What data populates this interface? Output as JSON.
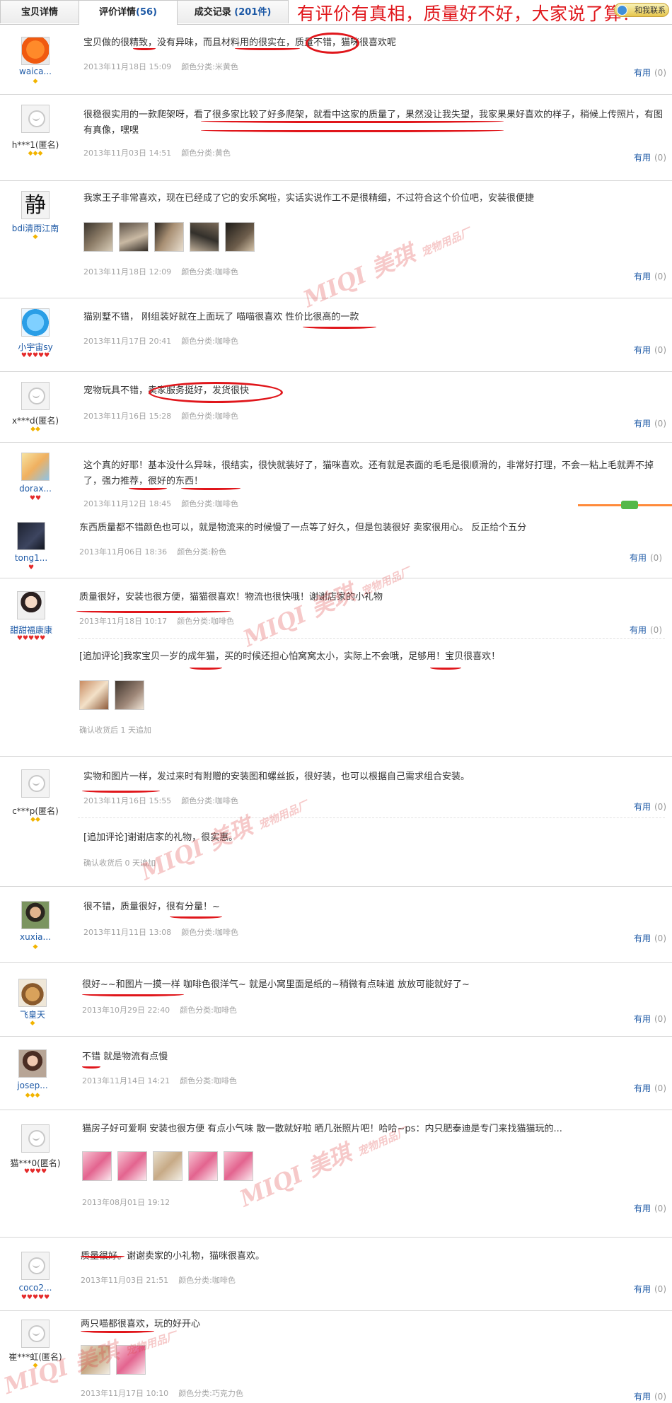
{
  "tabs": [
    {
      "label": "宝贝详情",
      "count": ""
    },
    {
      "label": "评价详情",
      "count": "56"
    },
    {
      "label": "成交记录",
      "count": "201件"
    }
  ],
  "slogan": "有评价有真相，质量好不好，大家说了算！",
  "contact_label": "和我联系",
  "useful_label": "有用",
  "watermark": {
    "brand": "MIQI 美琪",
    "sub": "宠物用品厂"
  },
  "reviews": [
    {
      "nick": "waica...",
      "level": "◆",
      "text": "宝贝做的很精致，没有异味，而且材料用的很实在，质量不错，猫咪很喜欢呢",
      "date": "2013年11月18日 15:09",
      "color": "颜色分类:米黄色",
      "useful_count": "(0)"
    },
    {
      "nick": "h***1(匿名)",
      "level": "◆◆◆",
      "text": "很稳很实用的一款爬架呀，看了很多家比较了好多爬架，就看中这家的质量了，果然没让我失望，我家果果好喜欢的样子，稍候上传照片，有图有真像，嘿嘿",
      "date": "2013年11月03日 14:51",
      "color": "颜色分类:黄色",
      "useful_count": "(0)"
    },
    {
      "nick": "bdi清雨江南",
      "level": "◆",
      "text": "我家王子非常喜欢，现在已经成了它的安乐窝啦，实话实说作工不是很精细，不过符合这个价位吧，安装很便捷",
      "date": "2013年11月18日 12:09",
      "color": "颜色分类:咖啡色",
      "useful_count": "(0)"
    },
    {
      "nick": "小宇宙sy",
      "level": "♥♥♥♥♥",
      "text": "猫别墅不错， 刚组装好就在上面玩了 喵喵很喜欢 性价比很高的一款",
      "date": "2013年11月17日 20:41",
      "color": "颜色分类:咖啡色",
      "useful_count": "(0)"
    },
    {
      "nick": "x***d(匿名)",
      "level": "◆◆",
      "text": "宠物玩具不错，卖家服务挺好，发货很快",
      "date": "2013年11月16日 15:28",
      "color": "颜色分类:咖啡色",
      "useful_count": "(0)"
    },
    {
      "nick": "dorax...",
      "level": "♥♥",
      "text": "这个真的好耶！基本没什么异味，很结实，很快就装好了，猫咪喜欢。还有就是表面的毛毛是很顺滑的，非常好打理，不会一粘上毛就弄不掉了，强力推荐，很好的东西！",
      "date": "2013年11月12日 18:45",
      "color": "颜色分类:咖啡色",
      "useful_count": ""
    },
    {
      "nick": "tong1...",
      "level": "♥",
      "text": "东西质量都不错颜色也可以，就是物流来的时候慢了一点等了好久，但是包装很好 卖家很用心。 反正给个五分",
      "date": "2013年11月06日 18:36",
      "color": "颜色分类:粉色",
      "useful_count": "(0)"
    },
    {
      "nick": "甜甜福康康",
      "level": "♥♥♥♥♥",
      "text": "质量很好，安装也很方便，猫猫很喜欢！物流也很快哦！谢谢店家的小礼物",
      "date": "2013年11月18日 10:17",
      "color": "颜色分类:咖啡色",
      "useful_count": "(0)",
      "append_text": "[追加评论]我家宝贝一岁的成年猫，买的时候还担心怕窝窝太小，实际上不会哦，足够用！宝贝很喜欢！",
      "append_meta": "确认收货后 1 天追加"
    },
    {
      "nick": "c***p(匿名)",
      "level": "◆◆",
      "text": "实物和图片一样，发过来时有附赠的安装图和螺丝扳，很好装，也可以根据自己需求组合安装。",
      "date": "2013年11月16日 15:55",
      "color": "颜色分类:咖啡色",
      "useful_count": "(0)",
      "append_text": "[追加评论]谢谢店家的礼物，很实惠。",
      "append_meta": "确认收货后 0 天追加"
    },
    {
      "nick": "xuxia...",
      "level": "◆",
      "text": "很不错，质量很好，很有分量！~",
      "date": "2013年11月11日 13:08",
      "color": "颜色分类:咖啡色",
      "useful_count": "(0)"
    },
    {
      "nick": "飞皇天",
      "level": "◆",
      "text": "很好~~和图片一摸一样 咖啡色很洋气~ 就是小窝里面是纸的~稍微有点味道 放放可能就好了~",
      "date": "2013年10月29日 22:40",
      "color": "颜色分类:咖啡色",
      "useful_count": "(0)"
    },
    {
      "nick": "josep...",
      "level": "◆◆◆",
      "text": "不错 就是物流有点慢",
      "date": "2013年11月14日 14:21",
      "color": "颜色分类:咖啡色",
      "useful_count": "(0)"
    },
    {
      "nick": "猫***0(匿名)",
      "level": "♥♥♥♥",
      "text": "猫房子好可爱啊 安装也很方便 有点小气味 散一散就好啦 晒几张照片吧！哈哈~ps：内只肥泰迪是专门来找猫猫玩的...",
      "date": "2013年08月01日 19:12",
      "color": "",
      "useful_count": "(0)"
    },
    {
      "nick": "coco2...",
      "level": "♥♥♥♥♥",
      "text": "质量很好。谢谢卖家的小礼物，猫咪很喜欢。",
      "date": "2013年11月03日 21:51",
      "color": "颜色分类:咖啡色",
      "useful_count": "(0)"
    },
    {
      "nick": "崔***虹(匿名)",
      "level": "◆",
      "text": "两只喵都很喜欢，玩的好开心",
      "date": "2013年11月17日 10:10",
      "color": "颜色分类:巧克力色",
      "useful_count": "(0)"
    }
  ]
}
